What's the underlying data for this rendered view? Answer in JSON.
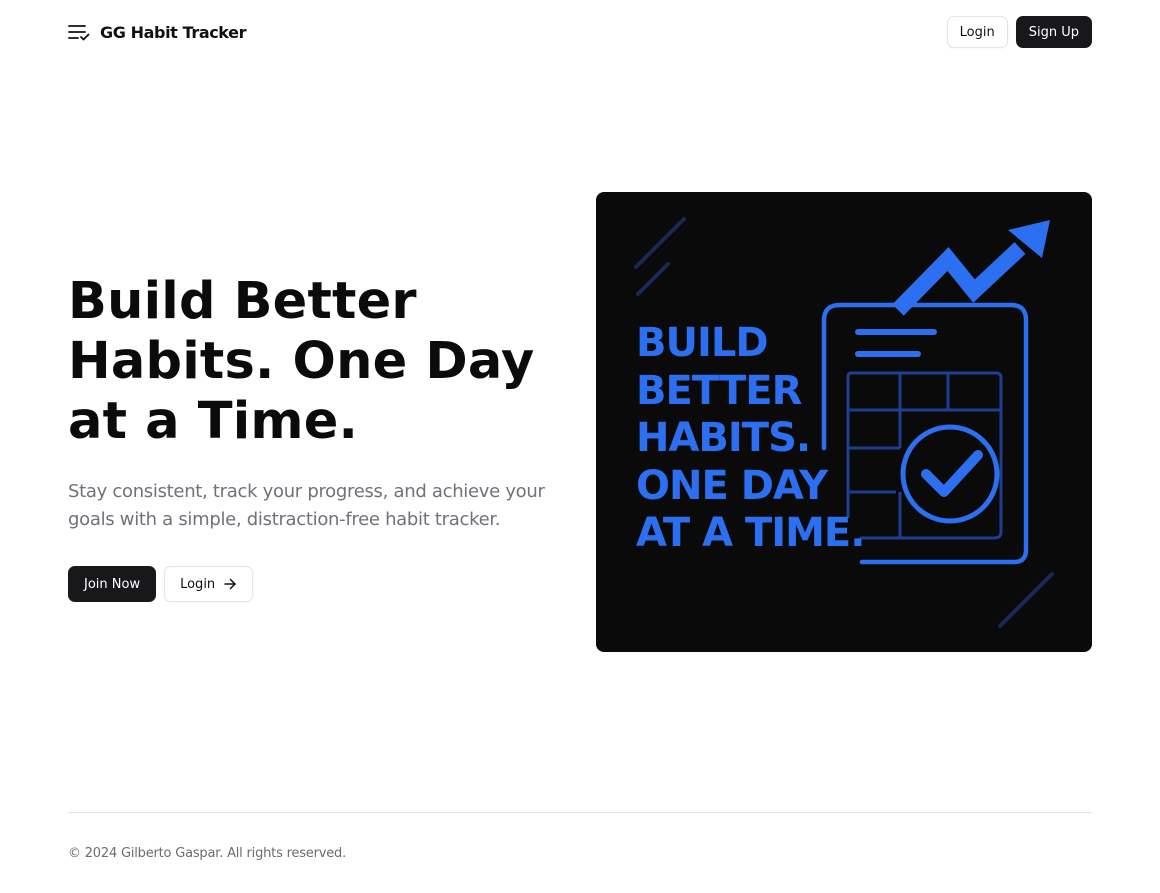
{
  "header": {
    "brand_name": "GG Habit Tracker",
    "brand_icon": "list-check-icon",
    "login_label": "Login",
    "signup_label": "Sign Up"
  },
  "hero": {
    "title_lines": [
      "Build Better",
      "Habits. One Day",
      "at a Time."
    ],
    "subtitle": "Stay consistent, track your progress, and achieve your goals with a simple, distraction-free habit tracker.",
    "join_label": "Join Now",
    "login_label": "Login",
    "login_icon": "arrow-right-icon"
  },
  "illustration": {
    "lines": [
      "BUILD",
      "BETTER",
      "HABITS.",
      "ONE DAY",
      "AT A TIME."
    ],
    "icons": [
      "trend-arrow-icon",
      "clipboard-icon",
      "check-circle-icon"
    ],
    "accent_color": "#2c6ff0",
    "background_color": "#0a0a0a"
  },
  "footer": {
    "copyright": "© 2024 Gilberto Gaspar. All rights reserved."
  },
  "colors": {
    "primary_dark": "#18181b",
    "muted_text": "#71717a",
    "border": "#e4e4e7"
  }
}
